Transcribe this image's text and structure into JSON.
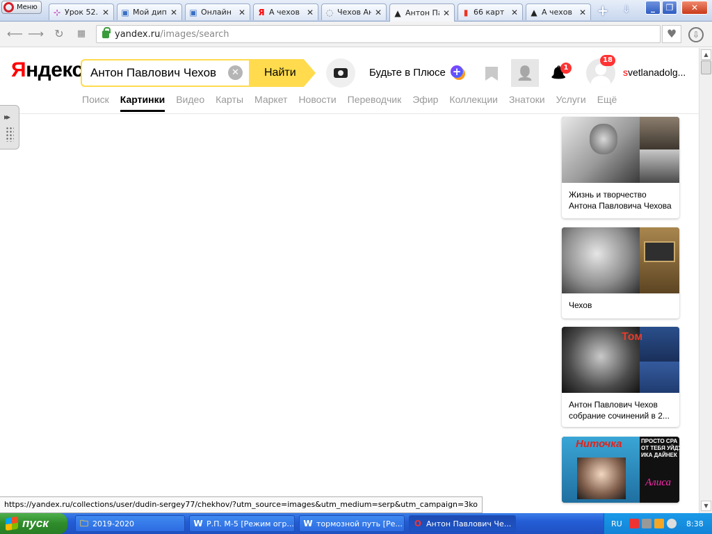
{
  "browser": {
    "menu_label": "Меню",
    "tabs": [
      {
        "label": "Урок 52.",
        "icon": "quiz-icon",
        "icon_char": "⊹",
        "color": "#c040c0"
      },
      {
        "label": "Мой дип",
        "icon": "page-icon",
        "icon_char": "▣",
        "color": "#3a6fc4"
      },
      {
        "label": "Онлайн",
        "icon": "page-icon",
        "icon_char": "▣",
        "color": "#3a6fc4"
      },
      {
        "label": "А чехов",
        "icon": "yandex-icon",
        "icon_char": "Я",
        "color": "#f00"
      },
      {
        "label": "Чехов Ан",
        "icon": "loading-icon",
        "icon_char": "◌",
        "color": "#777"
      },
      {
        "label": "Антон Па",
        "icon": "yandex-images-icon",
        "icon_char": "▲",
        "color": "#222",
        "active": true
      },
      {
        "label": "66 карт",
        "icon": "bookmark-red-icon",
        "icon_char": "▮",
        "color": "#e32"
      },
      {
        "label": "А чехов",
        "icon": "yandex-images-icon",
        "icon_char": "▲",
        "color": "#222"
      }
    ],
    "new_tab": "+",
    "tab_menu": "⇓",
    "win_buttons": [
      "_",
      "❐",
      "✕"
    ],
    "url_host": "yandex.ru",
    "url_path": "/images/search",
    "heart": "♥",
    "download": "⇩",
    "status_url": "https://yandex.ru/collections/user/dudin-sergey77/chekhov/?utm_source=images&utm_medium=serp&utm_campaign=3ko"
  },
  "yandex": {
    "logo_first": "Я",
    "logo_rest": "ндекс",
    "search_value": "Антон Павлович Чехов",
    "search_button": "Найти",
    "plus_text": "Будьте в Плюсе",
    "plus_badge": "+",
    "znatoki_glyph": "👤",
    "bell_glyph": "🔔",
    "notifications_count": "1",
    "avatar_count": "18",
    "username_first": "s",
    "username_rest": "vetlanadolg...",
    "services": [
      {
        "label": "Поиск",
        "active": false
      },
      {
        "label": "Картинки",
        "active": true
      },
      {
        "label": "Видео",
        "active": false
      },
      {
        "label": "Карты",
        "active": false
      },
      {
        "label": "Маркет",
        "active": false
      },
      {
        "label": "Новости",
        "active": false
      },
      {
        "label": "Переводчик",
        "active": false
      },
      {
        "label": "Эфир",
        "active": false
      },
      {
        "label": "Коллекции",
        "active": false
      },
      {
        "label": "Знатоки",
        "active": false
      },
      {
        "label": "Услуги",
        "active": false
      },
      {
        "label": "Ещё",
        "active": false
      }
    ],
    "collections": [
      {
        "title": "Жизнь и творчество Антона Павловича Чехова"
      },
      {
        "title": "Чехов"
      },
      {
        "title": "Антон Павлович Чехов собрание сочинений в 2..."
      },
      {
        "title": "Ниточка",
        "image_text_2": "ПРОСТО СРА\nОТ ТЕБЯ УЙДУ\nИКА ДАЙНЕК",
        "image_text_3": "Алиса"
      }
    ],
    "card3_overlay": "Том"
  },
  "taskbar": {
    "start_label": "пуск",
    "tasks": [
      {
        "label": "2019-2020",
        "icon_char": "🗀"
      },
      {
        "label": "Р.П. М-5 [Режим огр...",
        "icon_char": "W"
      },
      {
        "label": "тормозной путь [Ре...",
        "icon_char": "W"
      },
      {
        "label": "Антон Павлович Че...",
        "icon_char": "O",
        "active": true
      }
    ],
    "lang": "RU",
    "clock": "8:38"
  }
}
